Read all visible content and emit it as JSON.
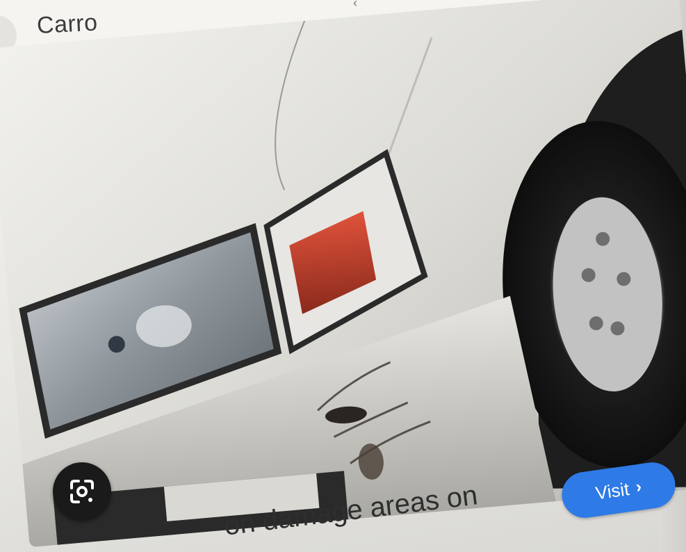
{
  "header": {
    "query_title": "Carro"
  },
  "result": {
    "image_alt_subject": "damaged car front bumper and headlight",
    "caption": "on damage areas on",
    "visit_label": "Visit",
    "visit_chevron": "›"
  },
  "icons": {
    "lens": "google-lens-icon",
    "back": "back-circle-icon"
  },
  "colors": {
    "visit_button": "#2e7ae6",
    "lens_button": "#1a1a1a",
    "header_bg": "#f5f4f0"
  }
}
